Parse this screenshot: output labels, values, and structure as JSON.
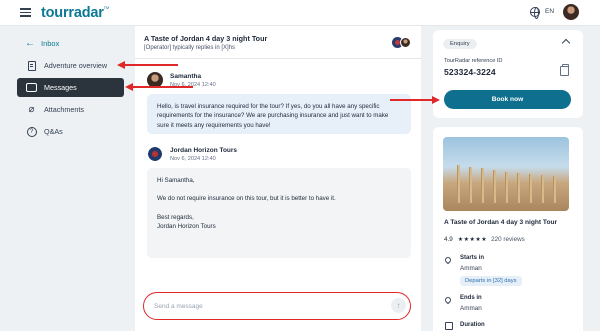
{
  "header": {
    "logo_text": "tourradar",
    "logo_tm": "TM",
    "language": "EN"
  },
  "nav": {
    "back_label": "Inbox",
    "items": [
      {
        "label": "Adventure overview",
        "icon": "document-icon",
        "active": false
      },
      {
        "label": "Messages",
        "icon": "message-icon",
        "active": true
      },
      {
        "label": "Attachments",
        "icon": "paperclip-icon",
        "active": false
      },
      {
        "label": "Q&As",
        "icon": "question-icon",
        "active": false
      }
    ]
  },
  "chat": {
    "title": "A Taste of Jordan 4 day 3 night Tour",
    "subtitle": "[Operator] typically replies in [X]hs",
    "messages": [
      {
        "sender": "Samantha",
        "date": "Nov 6, 2024 12:40",
        "body": "Hello, is travel insurance required for the tour? If yes, do you all have any specific requirements for the insurance? We are purchasing insurance and just want to make sure it meets any requirements you have!"
      },
      {
        "sender": "Jordan Horizon Tours",
        "date": "Nov 6, 2024 12:40",
        "greeting": "Hi Samantha,",
        "body": "We do not require insurance on this tour, but it is better to have it.",
        "signoff_1": "Best regards,",
        "signoff_2": "Jordan Horizon Tours"
      }
    ],
    "composer_placeholder": "Send a message",
    "send_icon": "↑"
  },
  "enquiry": {
    "badge": "Enquiry",
    "ref_label": "TourRadar reference ID",
    "ref_number": "523324-3224",
    "book_label": "Book now"
  },
  "tour": {
    "title": "A Taste of Jordan 4 day 3 night Tour",
    "rating": "4.9",
    "stars": "★★★★★",
    "reviews": "220 reviews",
    "starts_label": "Starts in",
    "starts_value": "Amman",
    "departs_badge": "Departs in [32] days",
    "ends_label": "Ends in",
    "ends_value": "Amman",
    "duration_label": "Duration"
  },
  "colors": {
    "brand": "#0c7a95",
    "book_button": "#0e6f8e",
    "nav_active": "#2b333c",
    "annotation": "#e02828"
  }
}
